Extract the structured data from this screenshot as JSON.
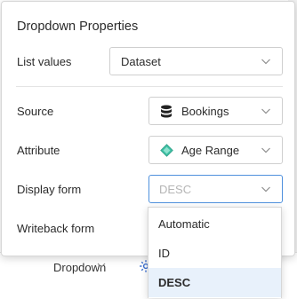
{
  "background": {
    "dropdown_label": "Dropdown",
    "settings_icon": "gear-icon"
  },
  "panel": {
    "title": "Dropdown Properties",
    "fields": {
      "list_values": {
        "label": "List values",
        "value": "Dataset",
        "icon": "chevron-down-icon"
      },
      "source": {
        "label": "Source",
        "value": "Bookings",
        "icon": "database-icon"
      },
      "attribute": {
        "label": "Attribute",
        "value": "Age Range",
        "icon": "diamond-icon",
        "icon_color": "#3fc1a5"
      },
      "display_form": {
        "label": "Display form",
        "value": "DESC"
      },
      "writeback_form": {
        "label": "Writeback form"
      }
    }
  },
  "menu": {
    "options": [
      "Automatic",
      "ID",
      "DESC"
    ],
    "selected": "DESC"
  },
  "colors": {
    "focus_border": "#4e90dd",
    "selected_bg": "#e8f1fb",
    "accent": "#3a6fd1"
  }
}
